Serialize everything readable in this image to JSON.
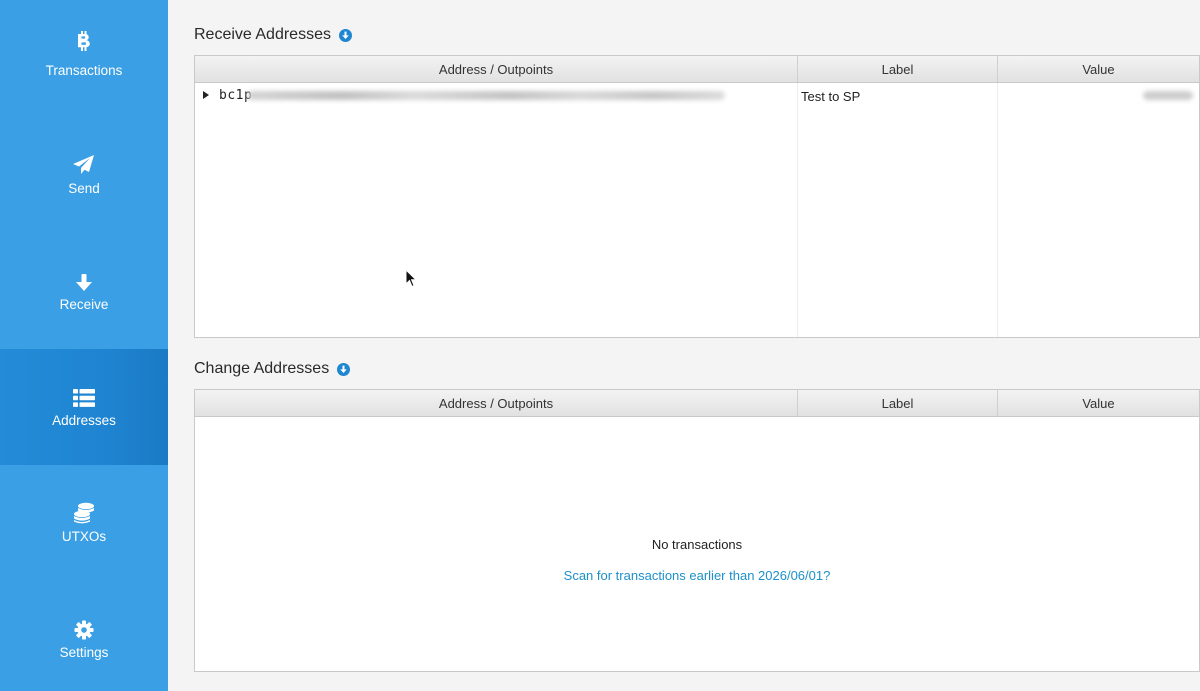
{
  "sidebar": {
    "items": [
      {
        "label": "Transactions",
        "icon": "bitcoin-icon",
        "active": false
      },
      {
        "label": "Send",
        "icon": "paper-plane-icon",
        "active": false
      },
      {
        "label": "Receive",
        "icon": "arrow-down-icon",
        "active": false
      },
      {
        "label": "Addresses",
        "icon": "list-icon",
        "active": true
      },
      {
        "label": "UTXOs",
        "icon": "coins-icon",
        "active": false
      },
      {
        "label": "Settings",
        "icon": "gear-icon",
        "active": false
      }
    ]
  },
  "receive": {
    "title": "Receive Addresses",
    "columns": [
      "Address / Outpoints",
      "Label",
      "Value"
    ],
    "rows": [
      {
        "address_prefix": "bc1p",
        "label": "Test to SP"
      }
    ]
  },
  "change": {
    "title": "Change Addresses",
    "columns": [
      "Address / Outpoints",
      "Label",
      "Value"
    ],
    "empty_text": "No transactions",
    "scan_link": "Scan for transactions earlier than 2026/06/01?"
  },
  "colors": {
    "sidebar": "#3a9fe4",
    "sidebar_active": "#1f85d2",
    "link": "#1e90c9",
    "accent_icon": "#1f86d1"
  }
}
